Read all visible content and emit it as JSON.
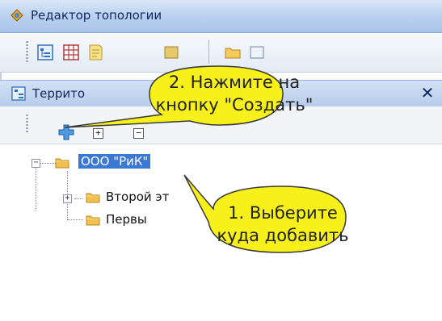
{
  "window": {
    "title": "Редактор топологии"
  },
  "panel": {
    "title": "Террито"
  },
  "tree": {
    "root": "ООО \"РиК\"",
    "children": [
      "Второй эт",
      "Первы"
    ]
  },
  "callouts": {
    "step2": {
      "line1": "2. Нажмите на",
      "line2": "кнопку \"Создать\""
    },
    "step1": {
      "line1": "1. Выберите",
      "line2": "куда добавить"
    }
  },
  "colors": {
    "selection": "#3a78d4",
    "callout_fill": "#f7f01a",
    "title_bar": "#b9cfee"
  }
}
